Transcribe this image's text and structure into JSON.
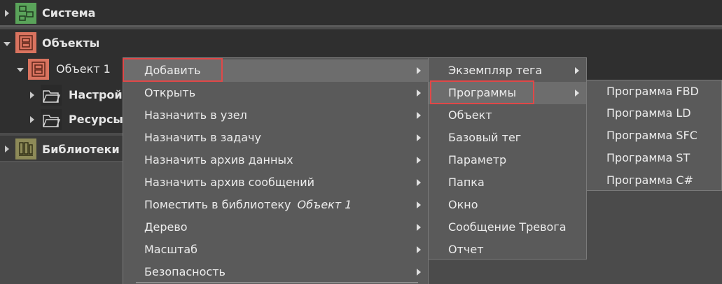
{
  "tree": {
    "sistema": {
      "label": "Система"
    },
    "obekty": {
      "label": "Объекты"
    },
    "obekt1": {
      "label": "Объект 1"
    },
    "nastroiki": {
      "label": "Настройк"
    },
    "resursy": {
      "label": "Ресурсы"
    },
    "biblioteki": {
      "label": "Библиотеки"
    }
  },
  "context_menu": {
    "items": [
      {
        "label": "Добавить",
        "suffix": ""
      },
      {
        "label": "Открыть",
        "suffix": ""
      },
      {
        "label": "Назначить в узел",
        "suffix": ""
      },
      {
        "label": "Назначить в задачу",
        "suffix": ""
      },
      {
        "label": "Назначить архив данных",
        "suffix": ""
      },
      {
        "label": "Назначить архив сообщений",
        "suffix": ""
      },
      {
        "label": "Поместить в библиотеку",
        "suffix": "Объект 1"
      },
      {
        "label": "Дерево",
        "suffix": ""
      },
      {
        "label": "Масштаб",
        "suffix": ""
      },
      {
        "label": "Безопасность",
        "suffix": ""
      }
    ]
  },
  "add_submenu": {
    "items": [
      {
        "label": "Экземпляр тега"
      },
      {
        "label": "Программы"
      },
      {
        "label": "Объект"
      },
      {
        "label": "Базовый тег"
      },
      {
        "label": "Параметр"
      },
      {
        "label": "Папка"
      },
      {
        "label": "Окно"
      },
      {
        "label": "Сообщение Тревога"
      },
      {
        "label": "Отчет"
      }
    ]
  },
  "programs_submenu": {
    "items": [
      {
        "label": "Программа FBD"
      },
      {
        "label": "Программа LD"
      },
      {
        "label": "Программа SFC"
      },
      {
        "label": "Программа ST"
      },
      {
        "label": "Программа C#"
      }
    ]
  },
  "colors": {
    "highlight_box": "#e04848",
    "sistema_icon": "#5aa35a",
    "obekty_icon": "#d9735f",
    "biblioteki_icon": "#8d8a58"
  }
}
